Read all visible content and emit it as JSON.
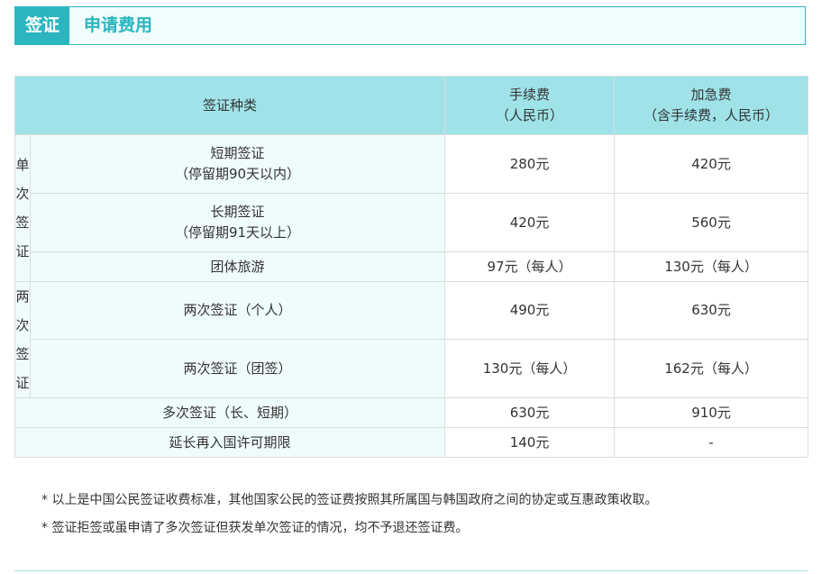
{
  "header": {
    "tab_label": "签证",
    "section_title": "申请费用"
  },
  "table": {
    "headers": {
      "type": "签证种类",
      "fee_line1": "手续费",
      "fee_line2": "（人民币）",
      "express_line1": "加急费",
      "express_line2": "（含手续费，人民币）"
    },
    "groups": {
      "single_chars": [
        "单",
        "次",
        "签",
        "证"
      ],
      "double_chars": [
        "两",
        "次",
        "签",
        "证"
      ]
    },
    "rows": [
      {
        "label1": "短期签证",
        "label2": "（停留期90天以内）",
        "fee": "280元",
        "express": "420元"
      },
      {
        "label1": "长期签证",
        "label2": "（停留期91天以上）",
        "fee": "420元",
        "express": "560元"
      },
      {
        "label1": "团体旅游",
        "fee": "97元（每人）",
        "express": "130元（每人）"
      },
      {
        "label1": "两次签证（个人）",
        "fee": "490元",
        "express": "630元"
      },
      {
        "label1": "两次签证（团签）",
        "fee": "130元（每人）",
        "express": "162元（每人）"
      },
      {
        "label1": "多次签证（长、短期）",
        "fee": "630元",
        "express": "910元"
      },
      {
        "label1": "延长再入国许可期限",
        "fee": "140元",
        "express": "-"
      }
    ]
  },
  "notes": [
    "* 以上是中国公民签证收费标准，其他国家公民的签证费按照其所属国与韩国政府之间的协定或互惠政策收取。",
    "* 签证拒签或虽申请了多次签证但获发单次签证的情况，均不予退还签证费。"
  ],
  "colors": {
    "accent": "#2bb5bf",
    "header_bg": "#9fe3e8",
    "label_bg": "#effcfc"
  }
}
